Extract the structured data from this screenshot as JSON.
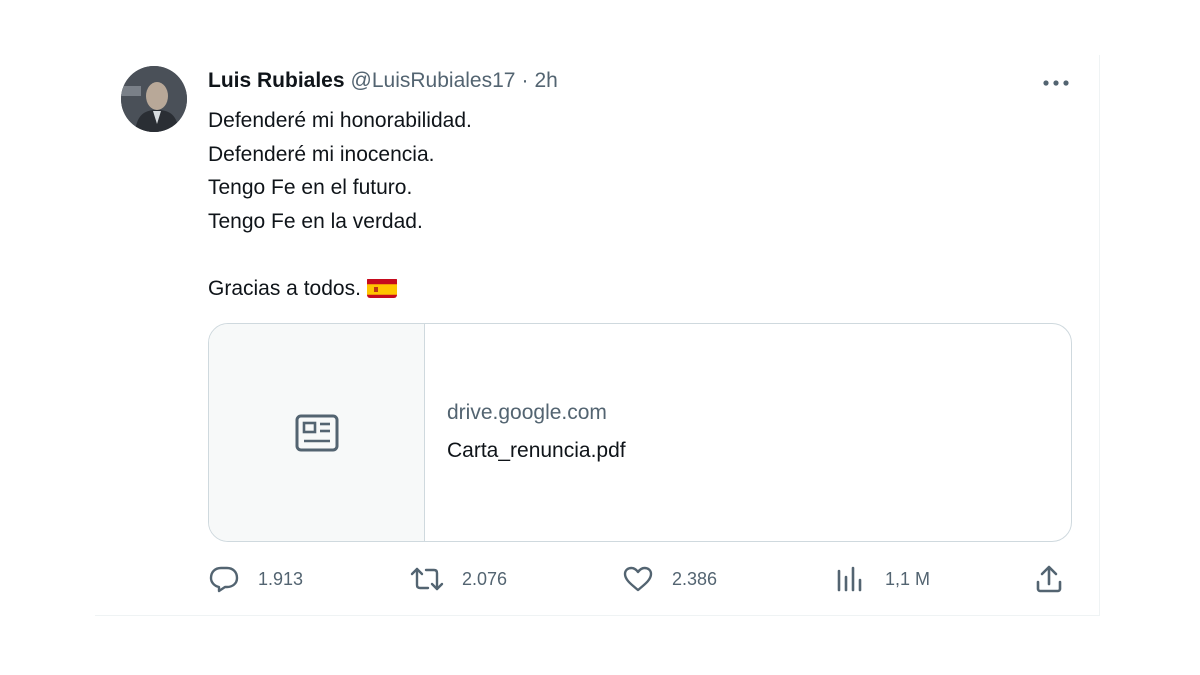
{
  "tweet": {
    "author_name": "Luis Rubiales",
    "handle": "@LuisRubiales17",
    "separator": "·",
    "timestamp": "2h",
    "text_lines": [
      "Defenderé mi honorabilidad.",
      "Defenderé mi inocencia.",
      "Tengo Fe en el futuro.",
      "Tengo Fe en la verdad.",
      "",
      "Gracias a todos."
    ],
    "emoji": "spain-flag-emoji",
    "card": {
      "domain": "drive.google.com",
      "title": "Carta_renuncia.pdf",
      "icon": "article-icon"
    },
    "actions": {
      "replies": "1.913",
      "retweets": "2.076",
      "likes": "2.386",
      "views": "1,1 M"
    }
  },
  "colors": {
    "text_primary": "#0f1419",
    "text_secondary": "#536471",
    "border": "#cfd9de",
    "card_thumb_bg": "#f7f9f9",
    "flag_red": "#c60b1e",
    "flag_yellow": "#ffc400"
  }
}
